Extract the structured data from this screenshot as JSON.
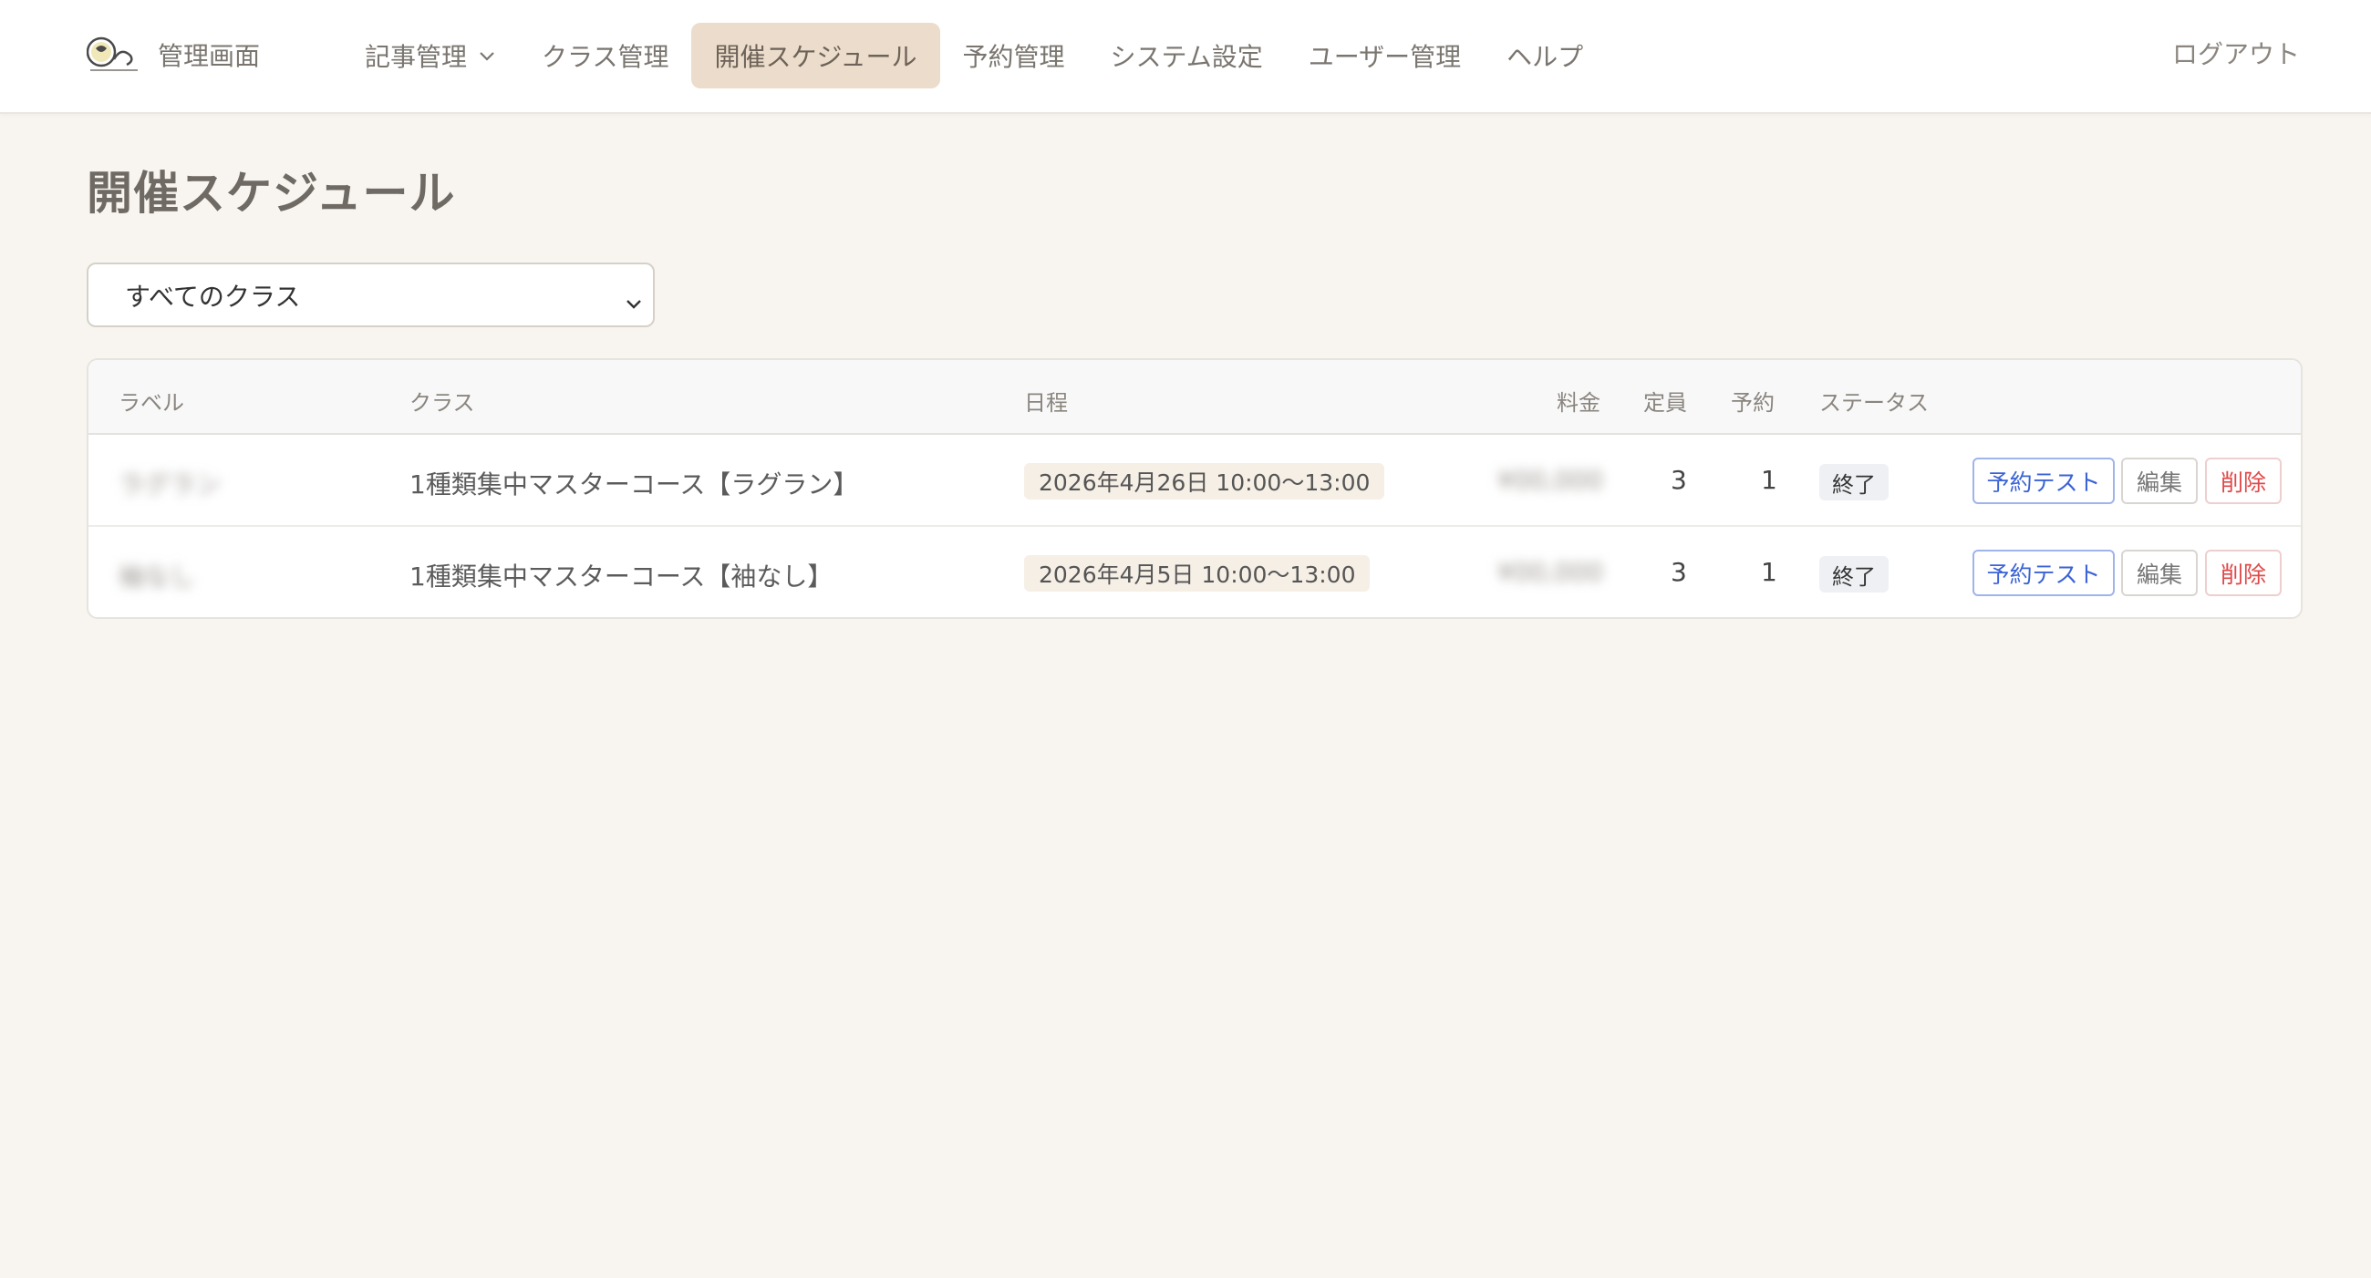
{
  "header": {
    "brand_label": "管理画面",
    "nav": [
      {
        "label": "記事管理",
        "dropdown": true,
        "active": false
      },
      {
        "label": "クラス管理",
        "active": false
      },
      {
        "label": "開催スケジュール",
        "active": true
      },
      {
        "label": "予約管理",
        "active": false
      },
      {
        "label": "システム設定",
        "active": false
      },
      {
        "label": "ユーザー管理",
        "active": false
      },
      {
        "label": "ヘルプ",
        "active": false
      }
    ],
    "logout_label": "ログアウト"
  },
  "page": {
    "title": "開催スケジュール",
    "filter": {
      "selected": "すべてのクラス"
    }
  },
  "table": {
    "columns": {
      "label": "ラベル",
      "class": "クラス",
      "date": "日程",
      "price": "料金",
      "capacity": "定員",
      "reserved": "予約",
      "status": "ステータス"
    },
    "rows": [
      {
        "label": "ラグラン",
        "class": "1種類集中マスターコース【ラグラン】",
        "date": "2026年4月26日 10:00〜13:00",
        "price": "¥00,000",
        "capacity": "3",
        "reserved": "1",
        "status": "終了",
        "actions": {
          "test": "予約テスト",
          "edit": "編集",
          "delete": "削除"
        }
      },
      {
        "label": "袖なし",
        "class": "1種類集中マスターコース【袖なし】",
        "date": "2026年4月5日 10:00〜13:00",
        "price": "¥00,000",
        "capacity": "3",
        "reserved": "1",
        "status": "終了",
        "actions": {
          "test": "予約テスト",
          "edit": "編集",
          "delete": "削除"
        }
      }
    ]
  },
  "colors": {
    "background": "#f8f5f1",
    "active_nav": "#ecdccb",
    "test_button": "#3b63d6",
    "delete_button": "#e04848"
  }
}
